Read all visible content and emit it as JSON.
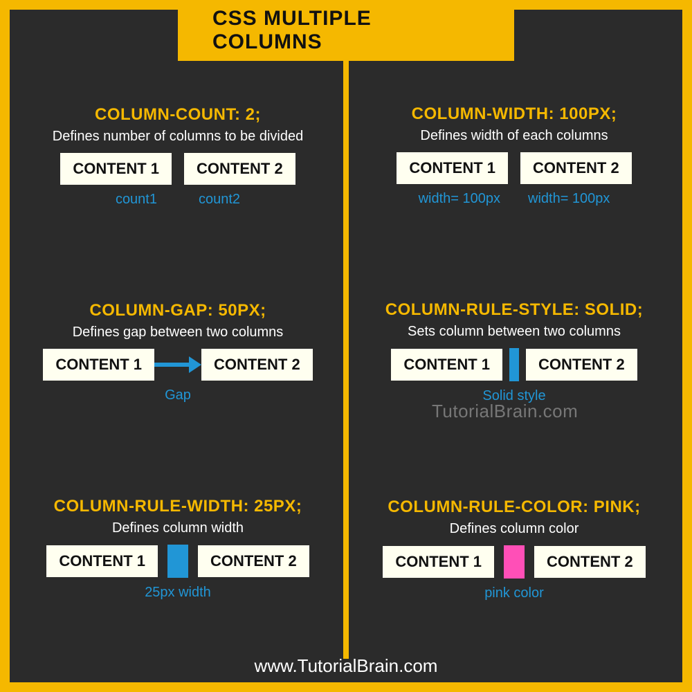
{
  "title": "CSS MULTIPLE COLUMNS",
  "footer": "www.TutorialBrain.com",
  "watermark": "TutorialBrain.com",
  "left": [
    {
      "property": "COLUMN-COUNT: 2;",
      "desc": "Defines number of columns to be divided",
      "box1": "CONTENT 1",
      "box2": "CONTENT 2",
      "cap1": "count1",
      "cap2": "count2"
    },
    {
      "property": "COLUMN-GAP: 50PX;",
      "desc": "Defines gap between two columns",
      "box1": "CONTENT 1",
      "box2": "CONTENT 2",
      "caption": "Gap"
    },
    {
      "property": "COLUMN-RULE-WIDTH: 25PX;",
      "desc": "Defines column width",
      "box1": "CONTENT 1",
      "box2": "CONTENT 2",
      "caption": "25px width"
    }
  ],
  "right": [
    {
      "property": "COLUMN-WIDTH: 100PX;",
      "desc": "Defines width of each columns",
      "box1": "CONTENT 1",
      "box2": "CONTENT 2",
      "cap1": "width= 100px",
      "cap2": "width= 100px"
    },
    {
      "property": "COLUMN-RULE-STYLE: SOLID;",
      "desc": "Sets column between two columns",
      "box1": "CONTENT 1",
      "box2": "CONTENT 2",
      "caption": "Solid style"
    },
    {
      "property": "COLUMN-RULE-COLOR: PINK;",
      "desc": "Defines column color",
      "box1": "CONTENT 1",
      "box2": "CONTENT 2",
      "caption": "pink color"
    }
  ]
}
